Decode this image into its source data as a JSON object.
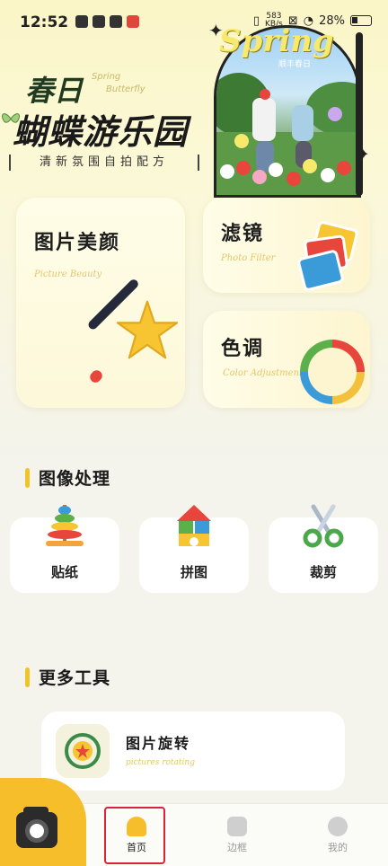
{
  "status_bar": {
    "time": "12:52",
    "net_speed_value": "583",
    "net_speed_unit": "KB/s",
    "battery": "28%"
  },
  "hero": {
    "title_line1": "春日",
    "title_en_1": "Spring",
    "title_en_2": "Butterfly",
    "title_line2": "蝴蝶游乐园",
    "tagline": "清新氛围自拍配方",
    "photo_title": "Spring",
    "photo_subtitle": "顺丰春日"
  },
  "features": {
    "beauty": {
      "title": "图片美颜",
      "subtitle": "Picture Beauty"
    },
    "filter": {
      "title": "滤镜",
      "subtitle": "Photo Filter"
    },
    "tone": {
      "title": "色调",
      "subtitle": "Color Adjustment"
    }
  },
  "image_processing": {
    "heading": "图像处理",
    "tools": [
      {
        "label": "贴纸",
        "icon": "ring-stacker-icon"
      },
      {
        "label": "拼图",
        "icon": "building-blocks-icon"
      },
      {
        "label": "裁剪",
        "icon": "scissors-icon"
      }
    ]
  },
  "more_tools": {
    "heading": "更多工具",
    "items": [
      {
        "title": "图片旋转",
        "subtitle": "pictures rotating",
        "icon": "rotate-badge-icon"
      }
    ]
  },
  "bottom_nav": {
    "items": [
      {
        "label": "首页",
        "icon": "home-icon",
        "active": true
      },
      {
        "label": "边框",
        "icon": "frame-icon",
        "active": false
      },
      {
        "label": "我的",
        "icon": "profile-icon",
        "active": false
      }
    ],
    "camera": "camera-icon"
  },
  "colors": {
    "accent": "#f5be2a",
    "highlight": "#d8233a",
    "background": "#f4f3ec"
  }
}
